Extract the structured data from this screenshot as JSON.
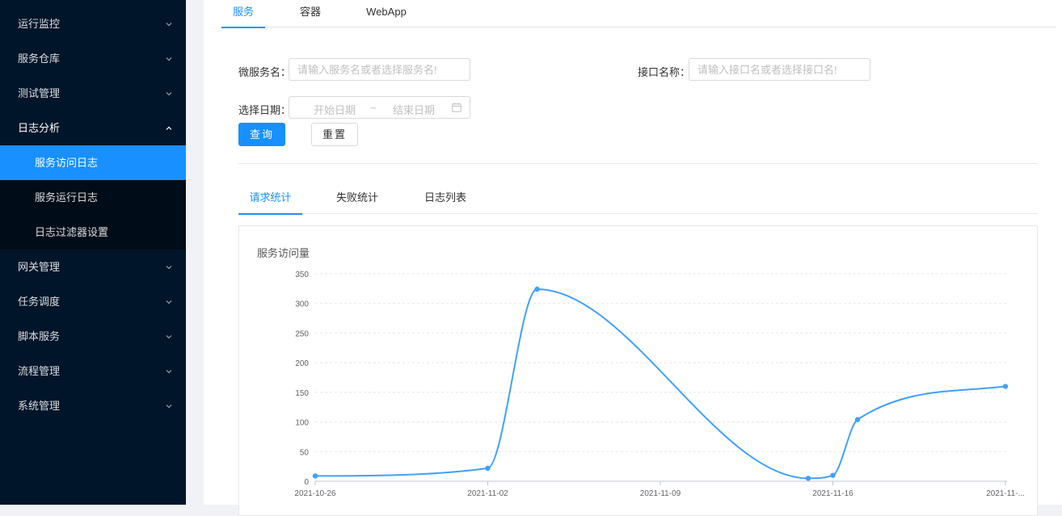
{
  "sidebar": {
    "items_before": [
      {
        "label": "运行监控"
      },
      {
        "label": "服务仓库"
      },
      {
        "label": "测试管理"
      }
    ],
    "open_item": {
      "label": "日志分析"
    },
    "sub_items": [
      {
        "label": "服务访问日志",
        "active": true
      },
      {
        "label": "服务运行日志"
      },
      {
        "label": "日志过滤器设置"
      }
    ],
    "items_after": [
      {
        "label": "网关管理"
      },
      {
        "label": "任务调度"
      },
      {
        "label": "脚本服务"
      },
      {
        "label": "流程管理"
      },
      {
        "label": "系统管理"
      }
    ]
  },
  "top_tabs": [
    {
      "label": "服务",
      "active": true
    },
    {
      "label": "容器"
    },
    {
      "label": "WebApp"
    }
  ],
  "form": {
    "service_label": "微服务名：",
    "service_placeholder": "请输入服务名或者选择服务名!",
    "api_label": "接口名称：",
    "api_placeholder": "请输入接口名或者选择接口名!",
    "date_label": "选择日期：",
    "start_placeholder": "开始日期",
    "separator": "~",
    "end_placeholder": "结束日期",
    "query_button": "查询",
    "reset_button": "重置"
  },
  "sub_tabs": [
    {
      "label": "请求统计",
      "active": true
    },
    {
      "label": "失败统计"
    },
    {
      "label": "日志列表"
    }
  ],
  "accent_color": "#1890ff",
  "chart_data": {
    "type": "line",
    "title": "服务访问量",
    "x_ticks": [
      "2021-10-26",
      "2021-11-02",
      "2021-11-09",
      "2021-11-16",
      "2021-11-..."
    ],
    "y_ticks": [
      "0",
      "50",
      "100",
      "150",
      "200",
      "250",
      "300",
      "350"
    ],
    "ylim": [
      0,
      350
    ],
    "grid": true,
    "smooth": true,
    "series": [
      {
        "color": "#40a0ff",
        "points": [
          {
            "x": "2021-10-26",
            "y": 9
          },
          {
            "x": "2021-11-02",
            "y": 22
          },
          {
            "x": "2021-11-04",
            "y": 324
          },
          {
            "x": "2021-11-15",
            "y": 5
          },
          {
            "x": "2021-11-16",
            "y": 10
          },
          {
            "x": "2021-11-17",
            "y": 104
          },
          {
            "x": "2021-11-23",
            "y": 160
          }
        ]
      }
    ]
  }
}
